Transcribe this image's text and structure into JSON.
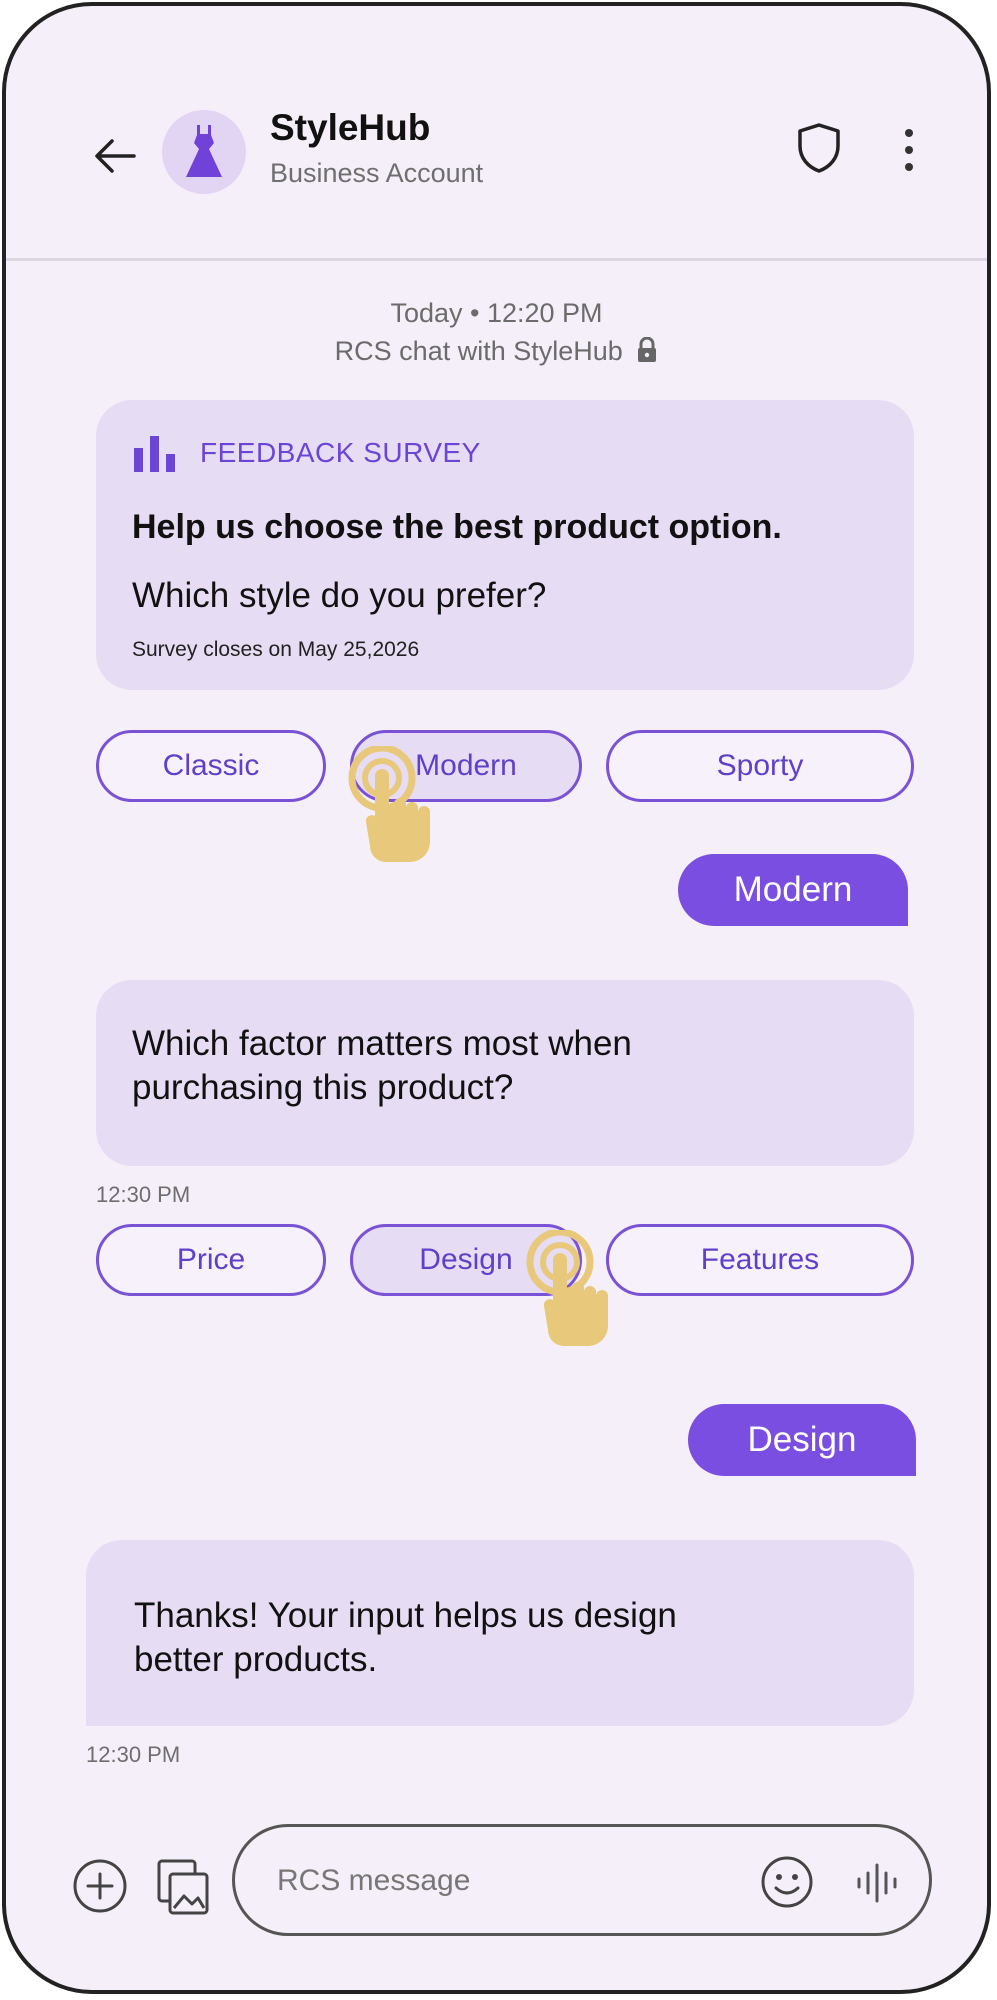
{
  "header": {
    "title": "StyleHub",
    "subtitle": "Business Account"
  },
  "chat": {
    "date_label": "Today • 12:20 PM",
    "rcs_note": "RCS chat with StyleHub"
  },
  "survey": {
    "label": "FEEDBACK SURVEY",
    "title": "Help us choose the best product option.",
    "question": "Which style do you prefer?",
    "closes": "Survey closes on May 25,2026",
    "options": [
      "Classic",
      "Modern",
      "Sporty"
    ],
    "selected": "Modern"
  },
  "question2": {
    "text_line1": "Which factor matters most when",
    "text_line2": "purchasing this product?",
    "time": "12:30 PM",
    "options": [
      "Price",
      "Design",
      "Features"
    ],
    "selected": "Design"
  },
  "thanks": {
    "text_line1": "Thanks! Your input helps us design",
    "text_line2": "better products.",
    "time": "12:30 PM"
  },
  "composer": {
    "placeholder": "RCS message"
  },
  "colors": {
    "accent": "#7a4ee0",
    "bubble": "#e6dcf3",
    "background": "#f5eff9",
    "hand": "#e8c87a"
  },
  "icons": [
    "back-arrow-icon",
    "dress-icon",
    "shield-icon",
    "more-vert-icon",
    "bar-chart-icon",
    "tap-hand-icon",
    "lock-icon",
    "add-icon",
    "image-icon",
    "emoji-icon",
    "voice-icon"
  ]
}
